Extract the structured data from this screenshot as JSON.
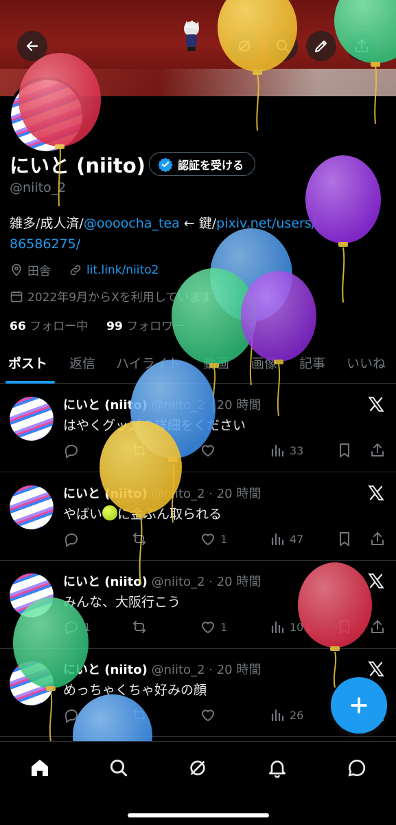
{
  "profile": {
    "name": "にいと (niito)",
    "verify_label": "認証を受ける",
    "handle": "@niito_2",
    "bio": {
      "prefix": "雑多/成人済/",
      "mention": "@oooocha_tea",
      "middle": " ← 鍵/",
      "link": "pixiv.net/users/",
      "link2": "86586275/"
    },
    "location": "田舎",
    "website": "lit.link/niito2",
    "joined": "2022年9月からXを利用しています",
    "following_count": "66",
    "following_label": "フォロー中",
    "followers_count": "99",
    "followers_label": "フォロワー"
  },
  "tabs": [
    "ポスト",
    "返信",
    "ハイライト",
    "動画",
    "画像",
    "記事",
    "いいね"
  ],
  "posts": [
    {
      "name": "にいと (niito)",
      "meta": "@niito_2 · 20 時間",
      "text": "はやくグッズの詳細をください",
      "replies": "",
      "retweets": "",
      "likes": "",
      "views": "33"
    },
    {
      "name": "にいと (niito)",
      "meta": "@niito_2 · 20 時間",
      "text_before": "やばい",
      "text_after": "に金ぶん取られる",
      "replies": "",
      "retweets": "",
      "likes": "1",
      "views": "47"
    },
    {
      "name": "にいと (niito)",
      "meta": "@niito_2 · 20 時間",
      "text": "みんな、大阪行こう",
      "replies": "1",
      "retweets": "",
      "likes": "1",
      "views": "101"
    },
    {
      "name": "にいと (niito)",
      "meta": "@niito_2 · 20 時間",
      "text": "めっちゃくちゃ好みの顔",
      "replies": "",
      "retweets": "",
      "likes": "",
      "views": "26"
    }
  ],
  "icons": {
    "back": "arrow-left-icon",
    "grok": "grok-icon",
    "search": "search-icon",
    "edit": "pencil-icon",
    "share": "share-icon",
    "home": "home-icon",
    "explore": "search-icon",
    "notifications": "bell-icon",
    "messages": "message-icon",
    "compose": "plus-icon"
  },
  "colors": {
    "accent": "#1d9bf0",
    "bg": "#000000",
    "muted": "#71767b"
  }
}
